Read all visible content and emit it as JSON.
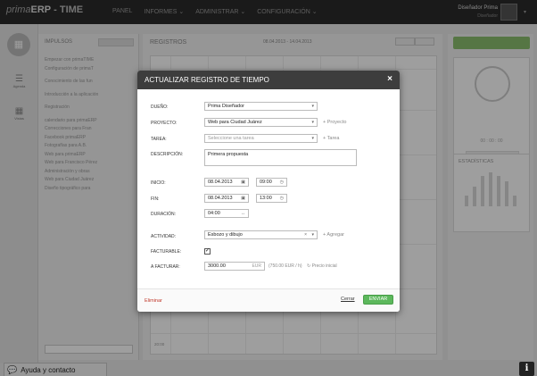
{
  "topbar": {
    "brand_light": "prima",
    "brand_bold": "ERP",
    "brand_product": "- TIME",
    "nav": [
      "PANEL",
      "INFORMES ⌄",
      "ADMINISTRAR ⌄",
      "CONFIGURACIÓN ⌄"
    ],
    "user_name": "Diseñador Prima",
    "user_role": "Diseñador"
  },
  "sidebar": {
    "items": [
      {
        "label": "Agenda",
        "icon": "list-icon"
      },
      {
        "label": "Vistas",
        "icon": "grid-icon"
      }
    ]
  },
  "impulsos": {
    "title": "IMPULSOS",
    "items": [
      "Empezar con primaTIME",
      "Configuración de primaT",
      "Conocimiento de las fun",
      "Introducción a la aplicación",
      "Registración",
      "calendario para primaERP",
      "Correcciones para Fran",
      "Facebook primaERP",
      "Fotografías para A.B.",
      "Web para primaERP",
      "Web para Francisco Pérez",
      "Administración y obras",
      "Web para Ciudad Juárez",
      "Diseño tipográfico para"
    ]
  },
  "registros": {
    "title": "REGISTROS",
    "range": "08.04.2013 - 14.04.2013",
    "time_label": "20:00"
  },
  "right": {
    "timer_value": "00 : 00 : 00",
    "timer_button": "▶ INICIAR",
    "stats_title": "ESTADÍSTICAS",
    "bar_levels": [
      0.3,
      0.55,
      0.85,
      0.95,
      0.85,
      0.7,
      0.3
    ]
  },
  "modal": {
    "title": "ACTUALIZAR REGISTRO DE TIEMPO",
    "close": "×",
    "labels": {
      "owner": "DUEÑO:",
      "project": "PROYECTO:",
      "task": "TAREA:",
      "description": "DESCRIPCIÓN:",
      "start": "INICIO:",
      "end": "FIN:",
      "duration": "DURACIÓN:",
      "activity": "ACTIVIDAD:",
      "billable": "FACTURABLE:",
      "to_bill": "A FACTURAR:"
    },
    "values": {
      "owner": "Prima Diseñador",
      "project": "Web para Ciudad Juárez",
      "task_placeholder": "Seleccione una tarea",
      "description": "Primera propuesta",
      "start_date": "08.04.2013",
      "start_time": "09:00",
      "end_date": "08.04.2013",
      "end_time": "13:00",
      "duration": "04:00",
      "activity": "Esbozo y dibujo",
      "billable": true,
      "amount": "3000.00",
      "currency": "EUR",
      "rate_note": "(750.00 EUR / h)",
      "initial_price": "Precio inicial"
    },
    "links": {
      "add_project": "+ Proyecto",
      "add_task": "+ Tarea",
      "add_activity": "+ Agregar"
    },
    "footer": {
      "delete": "Eliminar",
      "close": "Cerrar",
      "submit": "ENVIAR"
    }
  },
  "footer": {
    "help": "Ayuda y contacto",
    "info": "i"
  }
}
